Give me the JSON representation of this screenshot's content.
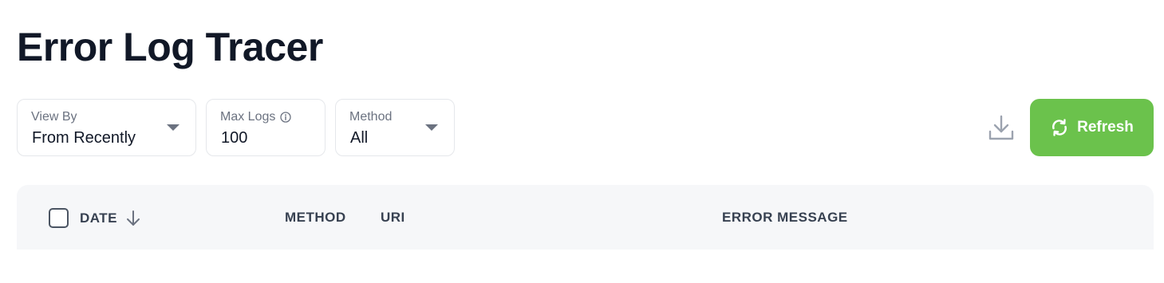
{
  "page": {
    "title": "Error Log Tracer"
  },
  "filters": {
    "view_by": {
      "label": "View By",
      "value": "From Recently"
    },
    "max_logs": {
      "label": "Max Logs",
      "value": "100"
    },
    "method": {
      "label": "Method",
      "value": "All"
    }
  },
  "actions": {
    "download_icon": "download-icon",
    "refresh_label": "Refresh",
    "refresh_icon": "refresh-icon",
    "refresh_color": "#6bc24c"
  },
  "table": {
    "columns": [
      "DATE",
      "METHOD",
      "URI",
      "ERROR MESSAGE"
    ],
    "sort_icon": "arrow-down-icon"
  }
}
